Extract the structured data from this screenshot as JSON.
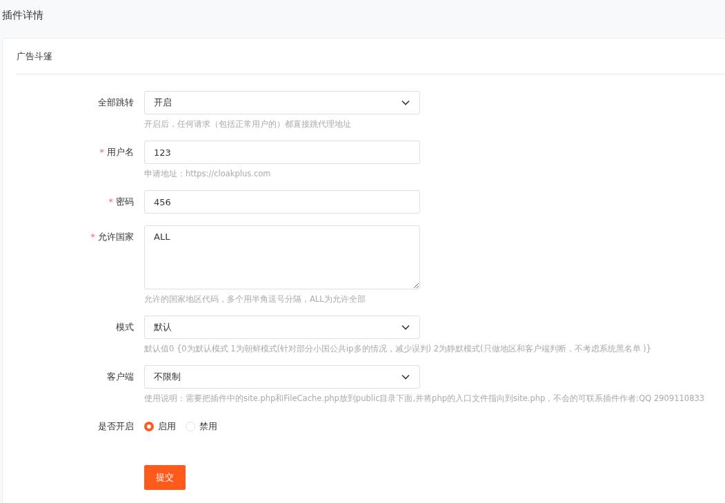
{
  "page_title": "插件详情",
  "card": {
    "title": "广告斗篷",
    "fields": [
      {
        "kind": "select",
        "label": "全部跳转",
        "value": "开启",
        "help": "开启后，任何请求（包括正常用户的）都直接跳代理地址"
      },
      {
        "kind": "input",
        "label": "用户名",
        "required_mark": "*",
        "value": "123",
        "help": "申请地址：https://cloakplus.com"
      },
      {
        "kind": "input",
        "label": "密码",
        "required_mark": "*",
        "value": "456"
      },
      {
        "kind": "textarea",
        "label": "允许国家",
        "required_mark": "*",
        "value": "ALL",
        "help": "允许的国家地区代码，多个用半角逗号分隔，ALL为允许全部"
      },
      {
        "kind": "select",
        "label": "模式",
        "value": "默认",
        "help": "默认值0 {0为默认模式 1为朝鲜模式(针对部分小国公共ip多的情况，减少误判) 2为静默模式(只做地区和客户端判断，不考虑系统黑名单 )}"
      },
      {
        "kind": "select",
        "label": "客户端",
        "value": "不限制",
        "help": "使用说明：需要把插件中的site.php和FileCache.php放到public目录下面,并将php的入口文件指向到site.php，不会的可联系插件作者:QQ 2909110833"
      },
      {
        "kind": "radio",
        "label": "是否开启",
        "options": [
          {
            "label": "启用",
            "selected": true
          },
          {
            "label": "禁用",
            "selected": false
          }
        ]
      }
    ],
    "submit": "提交"
  }
}
